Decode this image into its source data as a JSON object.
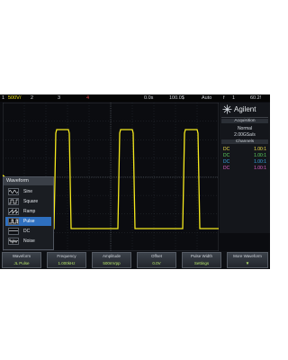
{
  "topbar": {
    "ch1": "1",
    "scale1": "500V/",
    "ch2": "2",
    "ch3": "3",
    "ch4": "4",
    "time_delay": "0.0s",
    "time_scale": "100.0$",
    "trig_mode": "Auto",
    "trig_icon": "f",
    "trig_ch": "1",
    "trig_level": "60.2!"
  },
  "side": {
    "brand": "Agilent",
    "acq_title": "Acquisition",
    "acq_mode": "Normal",
    "sample_rate": "2.00GSa/s",
    "channels_title": "Channels",
    "channels": [
      {
        "coupling": "DC",
        "scale": "1.00:1",
        "color": "#f3e24a"
      },
      {
        "coupling": "DC",
        "scale": "1.00:1",
        "color": "#5fd55f"
      },
      {
        "coupling": "DC",
        "scale": "1.00:1",
        "color": "#3aa8e8"
      },
      {
        "coupling": "DC",
        "scale": "1.00:1",
        "color": "#e060c8"
      }
    ]
  },
  "menu": {
    "title": "Waveform",
    "items": [
      {
        "label": "Sine",
        "icon": "sine-wave-icon",
        "selected": false
      },
      {
        "label": "Square",
        "icon": "square-wave-icon",
        "selected": false
      },
      {
        "label": "Ramp",
        "icon": "ramp-wave-icon",
        "selected": false
      },
      {
        "label": "Pulse",
        "icon": "pulse-wave-icon",
        "selected": true
      },
      {
        "label": "DC",
        "icon": "dc-wave-icon",
        "selected": false
      },
      {
        "label": "Noise",
        "icon": "noise-wave-icon",
        "selected": false
      }
    ]
  },
  "softkeys": [
    {
      "top": "Waveform",
      "bottom": "JL Pulse"
    },
    {
      "top": "Frequency",
      "bottom": "1.000kHz"
    },
    {
      "top": "Amplitude",
      "bottom": "500mVpp"
    },
    {
      "top": "Offset",
      "bottom": "0.0V"
    },
    {
      "top": "Pulse Width",
      "bottom": "Settings"
    },
    {
      "top": "More Waveform",
      "bottom": ""
    }
  ],
  "colors": {
    "trace": "#f4e81c",
    "grid": "#3b4048",
    "screen_bg": "#0b0c10",
    "accent": "#2e6fbf"
  }
}
